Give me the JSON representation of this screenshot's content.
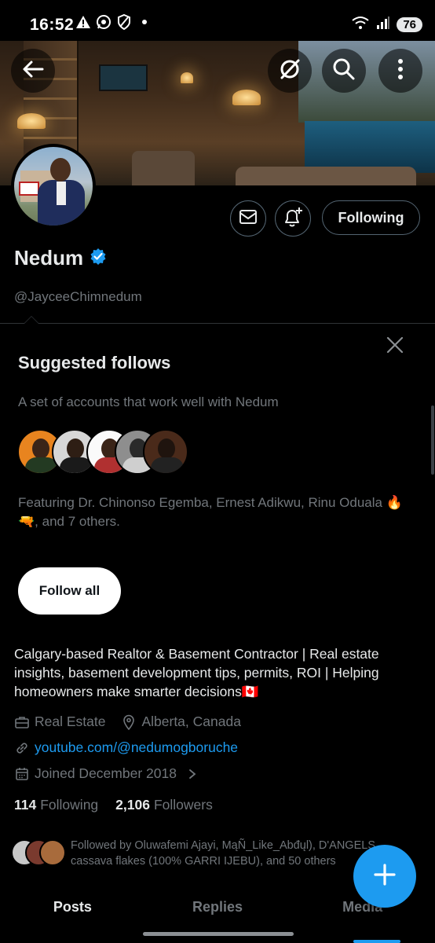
{
  "status_bar": {
    "time": "16:52",
    "battery": "76"
  },
  "profile": {
    "display_name": "Nedum",
    "handle": "@JayceeChimnedum",
    "follow_state_label": "Following",
    "verified": true,
    "bio": "Calgary-based Realtor & Basement Contractor | Real estate insights, basement development tips, permits, ROI | Helping homeowners make smarter decisions🇨🇦",
    "category": "Real Estate",
    "location": "Alberta, Canada",
    "website": "youtube.com/@nedumogboruche",
    "joined": "Joined December 2018",
    "following_count": "114",
    "following_label": "Following",
    "followers_count": "2,106",
    "followers_label": "Followers",
    "followed_by": "Followed by Oluwafemi Ajayi, MąÑ_Like_Abđųl), D'ANGELS cassava flakes (100% GARRI IJEBU), and 50 others"
  },
  "suggested": {
    "title": "Suggested follows",
    "subtitle": "A set of accounts that work well with Nedum",
    "featuring": "Featuring Dr. Chinonso Egemba, Ernest Adikwu, Rinu Oduala 🔥🔫, and 7 others.",
    "follow_all_label": "Follow all"
  },
  "tabs": [
    {
      "label": "Posts",
      "active": true
    },
    {
      "label": "Replies",
      "active": false
    },
    {
      "label": "Media",
      "active": false
    }
  ],
  "colors": {
    "accent": "#1d9bf0",
    "background": "#000000",
    "muted": "#71767b"
  },
  "icons": [
    "back-arrow-icon",
    "grok-icon",
    "search-icon",
    "more-vertical-icon",
    "mail-icon",
    "bell-plus-icon",
    "verified-badge-icon",
    "close-icon",
    "briefcase-icon",
    "location-pin-icon",
    "link-icon",
    "calendar-icon",
    "chevron-right-icon",
    "plus-icon"
  ]
}
